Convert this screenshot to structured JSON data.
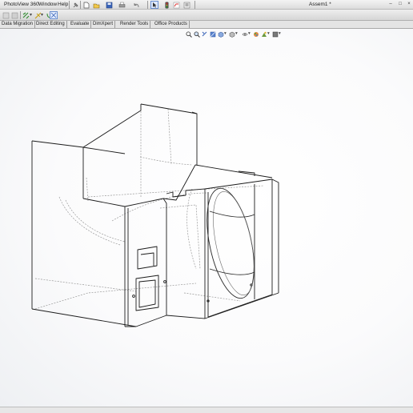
{
  "menubar": {
    "items": [
      "PhotoView 360",
      "Window",
      "Help"
    ],
    "document_title": "Assem1 *"
  },
  "tabs": [
    "Data Migration",
    "Direct Editing",
    "Evaluate",
    "DimXpert",
    "Render Tools",
    "Office Products"
  ],
  "colors": {
    "accent_blue": "#2f5fbf",
    "active_tab_border": "#4b78c8",
    "model_line": "#1c1c1c",
    "hidden_line": "#9a9a9a"
  },
  "icons": {
    "menubar": [
      "pin-icon",
      "new-document-icon",
      "open-icon",
      "save-icon",
      "print-icon",
      "undo-icon",
      "select-icon",
      "traffic-light-icon",
      "rebuild-icon",
      "options-icon"
    ],
    "heads_up_view": [
      "zoom-to-fit-icon",
      "zoom-area-icon",
      "previous-view-icon",
      "section-view-icon",
      "view-orientation-icon",
      "display-style-icon",
      "hide-show-icon",
      "edit-appearance-icon",
      "apply-scene-icon",
      "view-settings-icon"
    ]
  }
}
